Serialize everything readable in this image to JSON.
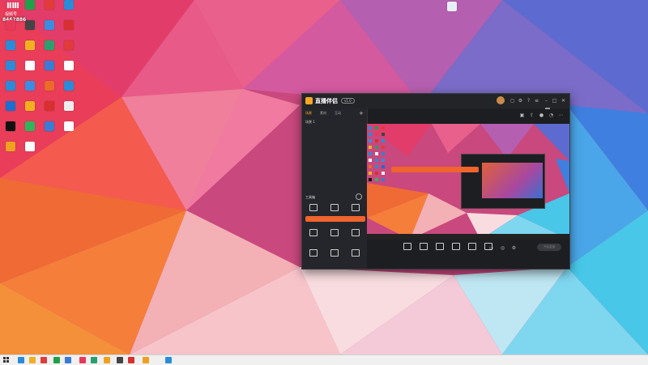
{
  "desktop": {
    "brand_logo": "ⅡⅢ",
    "brand_badge": "视频号",
    "brand_count": "8462886",
    "icons": [
      {
        "label": "",
        "color": "#2a8bd8"
      },
      {
        "label": "",
        "color": "#1fa14a"
      },
      {
        "label": "",
        "color": "#e23b3b"
      },
      {
        "label": "",
        "color": "#2a8bd8"
      },
      {
        "label": "",
        "color": "#e8395a"
      },
      {
        "label": "",
        "color": "#444444"
      },
      {
        "label": "",
        "color": "#3a8de0"
      },
      {
        "label": "",
        "color": "#d83030"
      },
      {
        "label": "",
        "color": "#2a8bd8"
      },
      {
        "label": "",
        "color": "#f0b020"
      },
      {
        "label": "",
        "color": "#2aa070"
      },
      {
        "label": "",
        "color": "#e03a3a"
      },
      {
        "label": "",
        "color": "#2a8bd8"
      },
      {
        "label": "",
        "color": "#ffffff"
      },
      {
        "label": "",
        "color": "#3a7bd5"
      },
      {
        "label": "",
        "color": "#ffffff"
      },
      {
        "label": "",
        "color": "#2a8bd8"
      },
      {
        "label": "",
        "color": "#3a8de0"
      },
      {
        "label": "",
        "color": "#ec6a2a"
      },
      {
        "label": "",
        "color": "#2a8bd8"
      },
      {
        "label": "",
        "color": "#1a6fd0"
      },
      {
        "label": "",
        "color": "#f0b020"
      },
      {
        "label": "",
        "color": "#d83030"
      },
      {
        "label": "",
        "color": "#eeeeee"
      },
      {
        "label": "",
        "color": "#111111"
      },
      {
        "label": "",
        "color": "#2fb55a"
      },
      {
        "label": "",
        "color": "#3a7bd5"
      },
      {
        "label": "",
        "color": "#ffffff"
      },
      {
        "label": "",
        "color": "#f0a020"
      },
      {
        "label": "",
        "color": "#ffffff"
      }
    ]
  },
  "app": {
    "title": "直播伴侣",
    "version": "v1.0",
    "tooltip": "",
    "sidebar": {
      "tabs": [
        "场景",
        "素材",
        "互动"
      ],
      "scene_item": "场景 1",
      "tools_title": "工具箱",
      "tools": [
        {
          "label": "",
          "icon": "chat-icon"
        },
        {
          "label": "",
          "icon": "user-icon"
        },
        {
          "label": "",
          "icon": "gift-icon"
        },
        {
          "label": "",
          "icon": "settings-icon"
        },
        {
          "label": "",
          "icon": "music-icon"
        },
        {
          "label": "",
          "icon": "list-icon"
        },
        {
          "label": "",
          "icon": "flag-icon"
        },
        {
          "label": "",
          "icon": "book-icon"
        },
        {
          "label": "",
          "icon": "trophy-icon"
        }
      ],
      "orange_bar": "",
      "footer": ""
    },
    "room": {
      "title": "",
      "tag": "",
      "btn1": "",
      "btn2": "",
      "stats": ""
    },
    "preview_banner": "",
    "bottom_buttons": [
      {
        "label": "",
        "icon": "screen-icon"
      },
      {
        "label": "",
        "icon": "camera-icon"
      },
      {
        "label": "",
        "icon": "window-icon"
      },
      {
        "label": "",
        "icon": "media-icon"
      },
      {
        "label": "",
        "icon": "mic-icon"
      },
      {
        "label": "",
        "icon": "speaker-icon"
      }
    ],
    "start_live": "开始直播",
    "bottom_footer": ""
  },
  "taskbar": {
    "time": "",
    "date": "",
    "icons": [
      "#2a8bd8",
      "#f0b020",
      "#e23b3b",
      "#1fa14a",
      "#3a7bd5",
      "#e8395a",
      "#2aa070",
      "#f0a020",
      "#444444",
      "#d83030",
      "#f0a020",
      "#2a8bd8"
    ]
  }
}
